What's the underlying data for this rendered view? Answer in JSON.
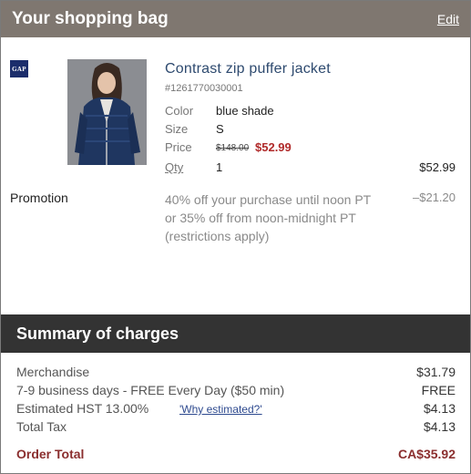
{
  "bag": {
    "title": "Your shopping bag",
    "edit_label": "Edit"
  },
  "brand": {
    "logo_text": "GAP",
    "logo_color": "#1b2d6b"
  },
  "item": {
    "name": "Contrast zip puffer jacket",
    "sku": "#1261770030001",
    "color_label": "Color",
    "color_value": "blue shade",
    "size_label": "Size",
    "size_value": "S",
    "price_label": "Price",
    "price_original": "$148.00",
    "price_sale": "$52.99",
    "qty_label": "Qty",
    "qty_value": "1",
    "line_total": "$52.99"
  },
  "promotion": {
    "label": "Promotion",
    "description": "40% off your purchase until noon PT or 35% off from noon-midnight PT (restrictions apply)",
    "amount": "–$21.20"
  },
  "summary": {
    "title": "Summary of charges",
    "merchandise_label": "Merchandise",
    "merchandise_value": "$31.79",
    "shipping_label": "7-9 business days - FREE Every Day ($50 min)",
    "shipping_value": "FREE",
    "hst_label": "Estimated HST 13.00%",
    "why_label": "'Why estimated?'",
    "hst_value": "$4.13",
    "tax_label": "Total Tax",
    "tax_value": "$4.13",
    "order_total_label": "Order Total",
    "order_total_value": "CA$35.92"
  },
  "colors": {
    "header_bg": "#7f7770",
    "summary_bg": "#333333",
    "sale_price": "#b02a2a",
    "order_total": "#8b2f2f",
    "product_link": "#2e4a6f"
  }
}
